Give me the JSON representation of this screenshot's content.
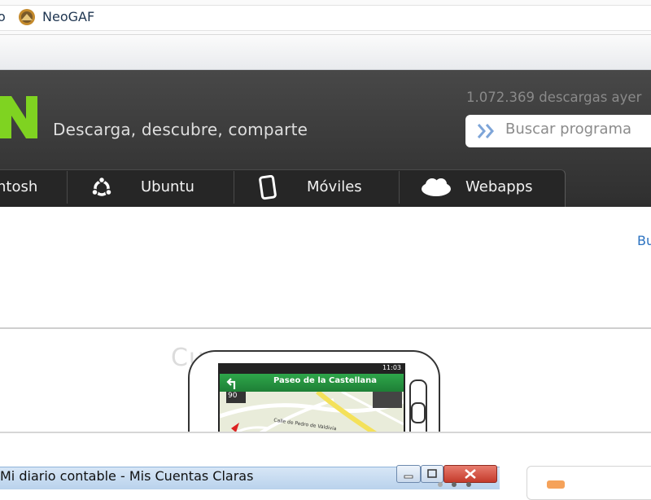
{
  "bookmarks": {
    "partial_item": "o",
    "neogaf_label": "NeoGAF"
  },
  "header": {
    "tagline": "Descarga, descubre, comparte",
    "downloads_counter": "1.072.369 descargas ayer",
    "search_placeholder": "Buscar programa",
    "brand_color": "#7fd321"
  },
  "nav": {
    "tabs": [
      {
        "label": "ntosh"
      },
      {
        "label": "Ubuntu",
        "icon": "ubuntu-icon"
      },
      {
        "label": "Móviles",
        "icon": "mobile-icon"
      },
      {
        "label": "Webapps",
        "icon": "cloud-icon"
      }
    ]
  },
  "content": {
    "partial_link": "Bu"
  },
  "featured": {
    "background_text": "Cu                     os",
    "phone": {
      "time": "11:03",
      "street": "Paseo de la Castellana",
      "speed": "90",
      "map_label": "Calle de Pedro de Valdivia"
    }
  },
  "window": {
    "title": "Mi diario contable - Mis Cuentas Claras"
  }
}
